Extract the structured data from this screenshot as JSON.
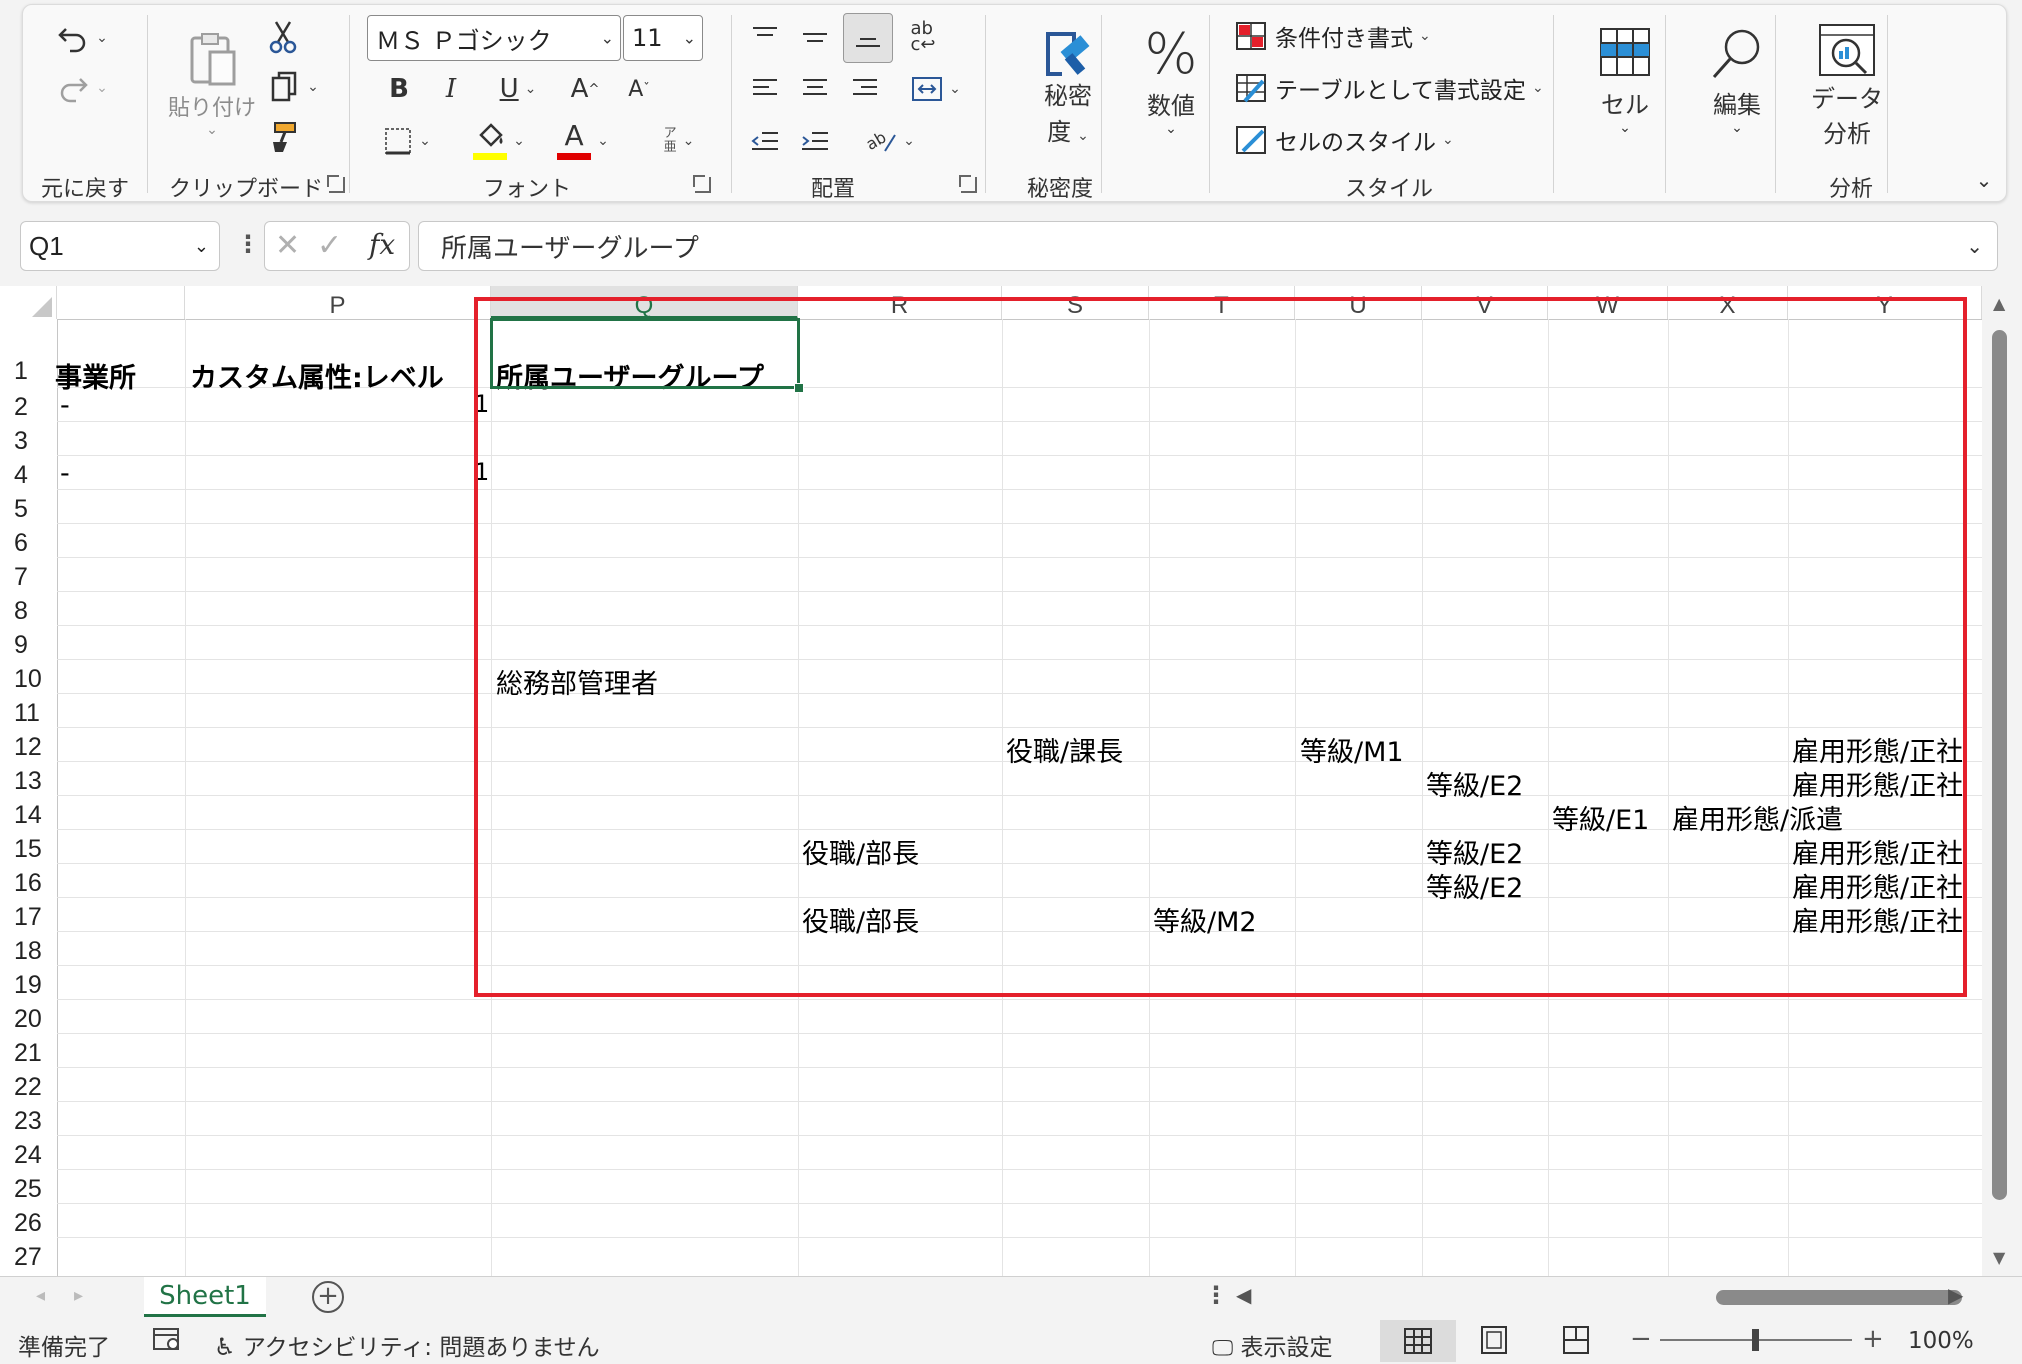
{
  "ribbon": {
    "undo_group_label": "元に戻す",
    "clipboard": {
      "paste_label": "貼り付け",
      "group_label": "クリップボード"
    },
    "font": {
      "name": "ＭＳ Ｐゴシック",
      "size": "11",
      "group_label": "フォント",
      "highlight_color": "#ffff00",
      "font_color": "#e00000"
    },
    "alignment": {
      "group_label": "配置"
    },
    "sensitivity": {
      "button_label_1": "秘密",
      "button_label_2": "度",
      "group_label": "秘密度"
    },
    "number": {
      "button_label": "数値"
    },
    "styles": {
      "conditional_formatting": "条件付き書式",
      "format_as_table": "テーブルとして書式設定",
      "cell_styles": "セルのスタイル",
      "group_label": "スタイル"
    },
    "cells": {
      "button_label": "セル"
    },
    "editing": {
      "button_label": "編集"
    },
    "analysis": {
      "button_label_1": "データ",
      "button_label_2": "分析",
      "group_label": "分析"
    }
  },
  "formula_bar": {
    "name_box": "Q1",
    "fx_label": "fx",
    "content": "所属ユーザーグループ"
  },
  "grid": {
    "columns": [
      "P",
      "Q",
      "R",
      "S",
      "T",
      "U",
      "V",
      "W",
      "X",
      "Y"
    ],
    "selected_column": "Q",
    "rows": [
      "1",
      "2",
      "3",
      "4",
      "5",
      "6",
      "7",
      "8",
      "9",
      "10",
      "11",
      "12",
      "13",
      "14",
      "15",
      "16",
      "17",
      "18",
      "19",
      "20",
      "21",
      "22",
      "23",
      "24",
      "25",
      "26",
      "27"
    ],
    "cells": {
      "o1": "事業所",
      "p1": "カスタム属性:レベル",
      "q1": "所属ユーザーグループ",
      "o2": "-",
      "p2": "1",
      "o4": "-",
      "p4": "1",
      "q10": "総務部管理者",
      "s12": "役職/課長",
      "u12": "等級/M1",
      "y12": "雇用形態/正社",
      "v13": "等級/E2",
      "y13": "雇用形態/正社",
      "w14": "等級/E1",
      "x14": "雇用形態/派遣",
      "r15": "役職/部長",
      "v15": "等級/E2",
      "y15": "雇用形態/正社",
      "v16": "等級/E2",
      "y16": "雇用形態/正社",
      "r17": "役職/部長",
      "t17": "等級/M2",
      "y17": "雇用形態/正社"
    }
  },
  "sheet_tabs": {
    "active": "Sheet1"
  },
  "status_bar": {
    "ready": "準備完了",
    "accessibility": "アクセシビリティ: 問題ありません",
    "display_settings": "表示設定",
    "zoom": "100%"
  },
  "colors": {
    "excel_green": "#217346",
    "annotation_red": "#e4202b"
  }
}
